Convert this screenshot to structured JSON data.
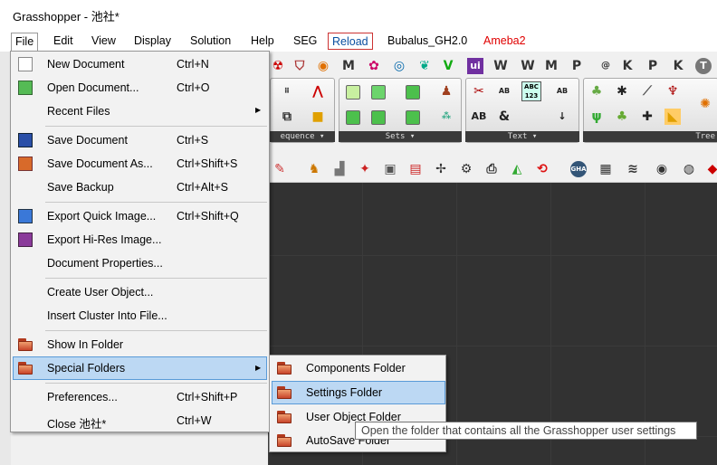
{
  "window": {
    "title": "Grasshopper - 池社*"
  },
  "menubar": {
    "items": [
      {
        "label": "File"
      },
      {
        "label": "Edit"
      },
      {
        "label": "View"
      },
      {
        "label": "Display"
      },
      {
        "label": "Solution"
      },
      {
        "label": "Help"
      },
      {
        "label": "SEG"
      },
      {
        "label": "Reload"
      },
      {
        "label": "Bubalus_GH2.0"
      },
      {
        "label": "Ameba2"
      }
    ]
  },
  "toolbar": {
    "tab_letters": [
      "M",
      "V",
      "W",
      "M",
      "P",
      "K",
      "P",
      "K"
    ],
    "panels": [
      "equence",
      "Sets",
      "Text",
      "Tree"
    ],
    "icons": {
      "logic_a": "AB",
      "logic_b": "ABC 123",
      "logic_c": "AB",
      "logic_d": "&",
      "gha": "GHA"
    }
  },
  "file_menu": {
    "items": [
      {
        "label": "New Document",
        "shortcut": "Ctrl+N"
      },
      {
        "label": "Open Document...",
        "shortcut": "Ctrl+O"
      },
      {
        "label": "Recent Files",
        "shortcut": ""
      },
      {
        "label": "Save Document",
        "shortcut": "Ctrl+S"
      },
      {
        "label": "Save Document As...",
        "shortcut": "Ctrl+Shift+S"
      },
      {
        "label": "Save Backup",
        "shortcut": "Ctrl+Alt+S"
      },
      {
        "label": "Export Quick Image...",
        "shortcut": "Ctrl+Shift+Q"
      },
      {
        "label": "Export Hi-Res Image...",
        "shortcut": ""
      },
      {
        "label": "Document Properties...",
        "shortcut": ""
      },
      {
        "label": "Create User Object...",
        "shortcut": ""
      },
      {
        "label": "Insert Cluster Into File...",
        "shortcut": ""
      },
      {
        "label": "Show In Folder",
        "shortcut": ""
      },
      {
        "label": "Special Folders",
        "shortcut": ""
      },
      {
        "label": "Preferences...",
        "shortcut": "Ctrl+Shift+P"
      },
      {
        "label": "Close 池社*",
        "shortcut": "Ctrl+W"
      }
    ]
  },
  "special_folders_menu": {
    "items": [
      {
        "label": "Components Folder"
      },
      {
        "label": "Settings Folder"
      },
      {
        "label": "User Object Folder"
      },
      {
        "label": "AutoSave Folder"
      }
    ]
  },
  "tooltip": {
    "text": "Open the folder that contains all the Grasshopper user settings"
  },
  "colors": {
    "highlight": "#bcd8f3",
    "canvas": "#323232",
    "accent_red": "#e00000"
  }
}
